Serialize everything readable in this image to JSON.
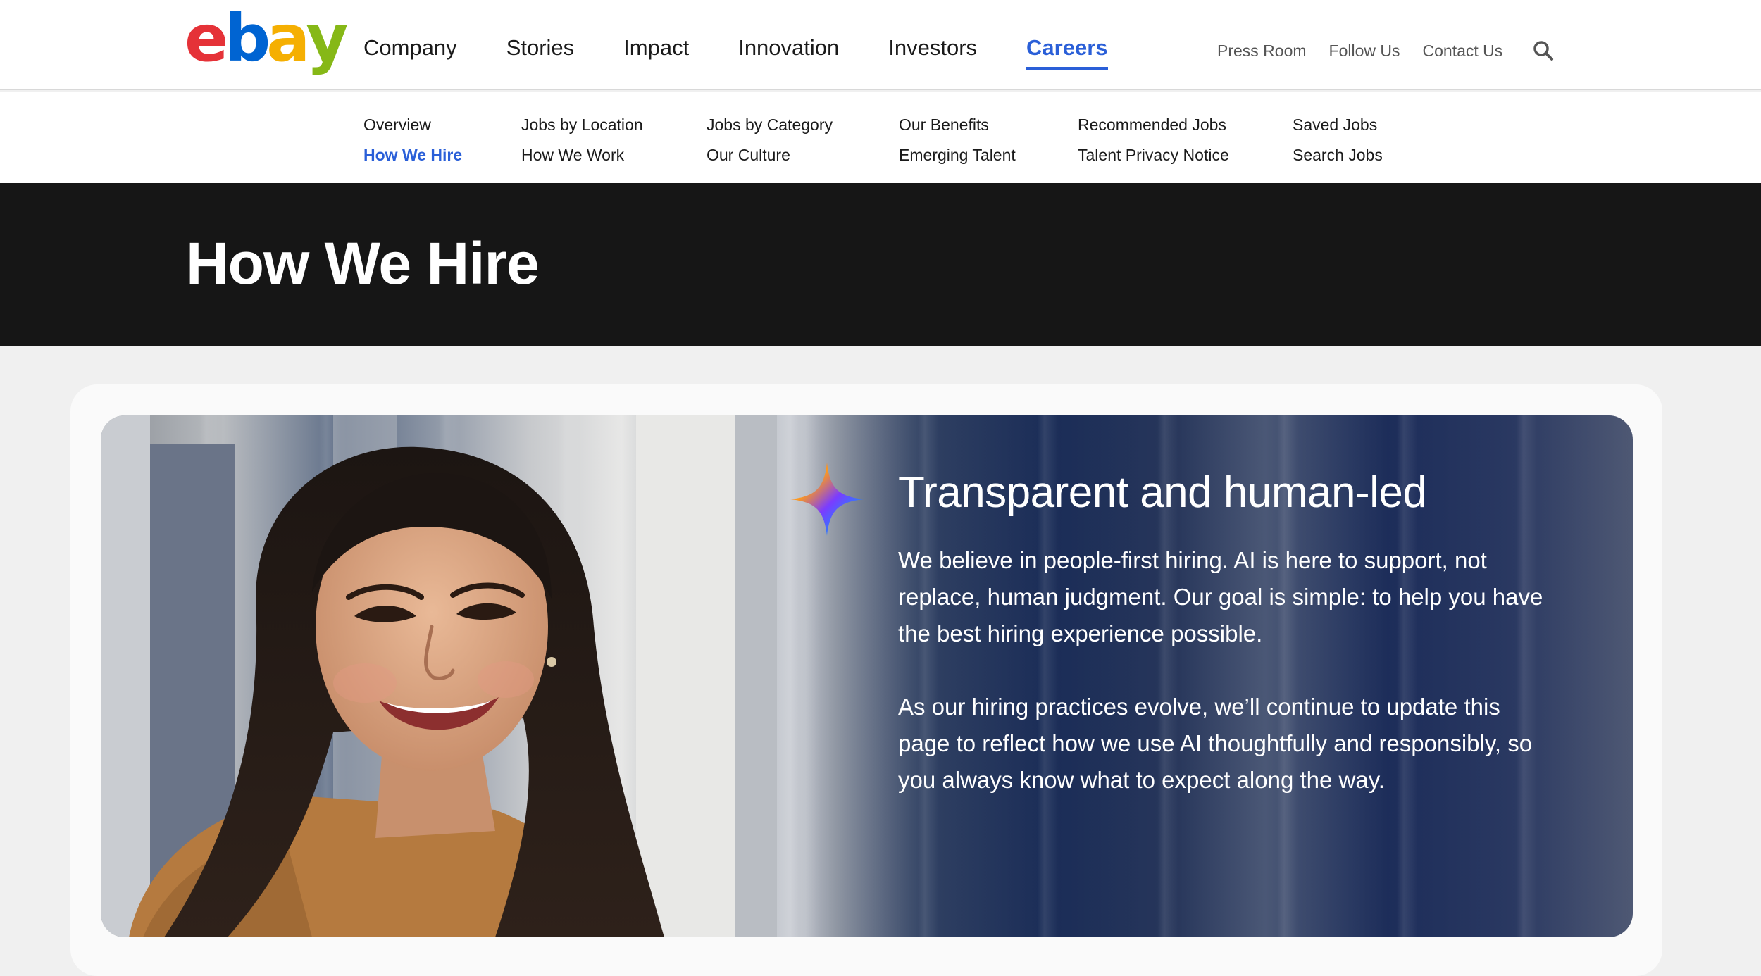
{
  "header": {
    "logo_alt": "ebay",
    "nav": [
      {
        "label": "Company"
      },
      {
        "label": "Stories"
      },
      {
        "label": "Impact"
      },
      {
        "label": "Innovation"
      },
      {
        "label": "Investors"
      },
      {
        "label": "Careers",
        "active": true
      }
    ],
    "utility": [
      {
        "label": "Press Room"
      },
      {
        "label": "Follow Us"
      },
      {
        "label": "Contact Us"
      }
    ],
    "search_icon": "search-icon"
  },
  "subnav": {
    "columns": [
      [
        "Overview",
        "How We Hire"
      ],
      [
        "Jobs by Location",
        "How We Work"
      ],
      [
        "Jobs by Category",
        "Our Culture"
      ],
      [
        "Our Benefits",
        "Emerging Talent"
      ],
      [
        "Recommended Jobs",
        "Talent Privacy Notice"
      ],
      [
        "Saved Jobs",
        "Search Jobs"
      ]
    ],
    "active": "How We Hire"
  },
  "hero": {
    "title": "How We Hire"
  },
  "feature": {
    "icon": "sparkle-icon",
    "heading": "Transparent and human-led",
    "paragraphs": [
      "We believe in people-first hiring. AI is here to support, not replace, human judgment. Our goal is simple: to help you have the best hiring experience possible.",
      "As our hiring practices evolve, we’ll continue to update this page to reflect how we use AI thoughtfully and responsibly, so you always know what to expect along the way."
    ]
  },
  "colors": {
    "accent": "#2a5fd8",
    "hero_bg": "#161616",
    "page_bg": "#f0f0f0",
    "logo_e": "#e53238",
    "logo_b": "#0064d2",
    "logo_a": "#f5af02",
    "logo_y": "#86b817"
  }
}
